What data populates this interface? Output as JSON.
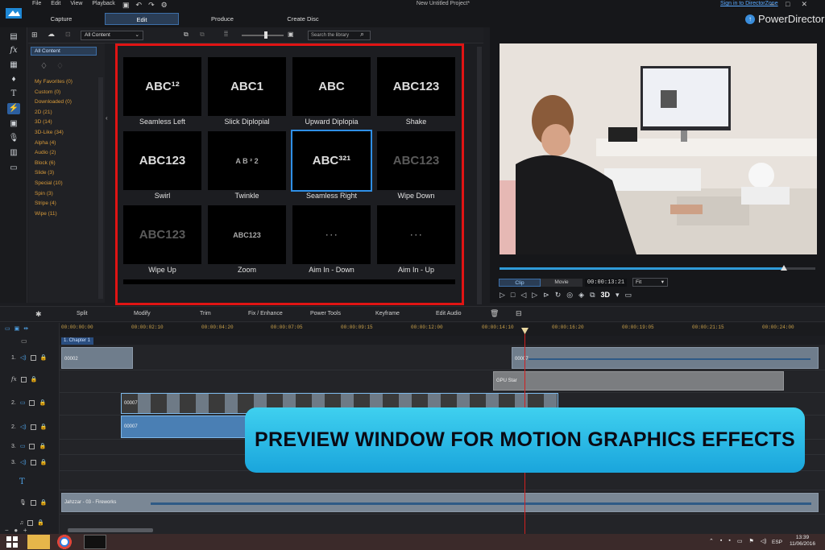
{
  "app": {
    "menu": [
      "File",
      "Edit",
      "View",
      "Playback"
    ],
    "project_title": "New Untitled Project*",
    "sign_in": "Sign in to DirectorZone",
    "brand": "PowerDirector",
    "modes": [
      "Capture",
      "Edit",
      "Produce",
      "Create Disc"
    ],
    "active_mode": "Edit"
  },
  "library": {
    "filter_value": "All Content",
    "search_placeholder": "Search the library",
    "categories_selected": "All Content",
    "categories": [
      "My Favorites  (0)",
      "Custom  (0)",
      "Downloaded  (0)",
      "2D  (21)",
      "3D  (14)",
      "3D-Like  (34)",
      "Alpha  (4)",
      "Audio  (2)",
      "Block  (6)",
      "Slide  (3)",
      "Special  (10)",
      "Spin  (3)",
      "Stripe  (4)",
      "Wipe  (11)"
    ],
    "tiles": [
      {
        "label": "Seamless Left",
        "thumb": "ABC¹²"
      },
      {
        "label": "Slick Diplopial",
        "thumb": "ABC1"
      },
      {
        "label": "Upward Diplopia",
        "thumb": "ABC"
      },
      {
        "label": "Shake",
        "thumb": "ABC123"
      },
      {
        "label": "Swirl",
        "thumb": "ABC123"
      },
      {
        "label": "Twinkle",
        "thumb": "A B ²  2"
      },
      {
        "label": "Seamless Right",
        "thumb": "ABC³²¹"
      },
      {
        "label": "Wipe Down",
        "thumb": "ABC123"
      },
      {
        "label": "Wipe Up",
        "thumb": "ABC123"
      },
      {
        "label": "Zoom",
        "thumb": "ABC123"
      },
      {
        "label": "Aim In - Down",
        "thumb": "· · ·"
      },
      {
        "label": "Aim In - Up",
        "thumb": "· · ·"
      }
    ]
  },
  "preview": {
    "tabs": [
      "Clip",
      "Movie"
    ],
    "active_tab": "Clip",
    "timecode": "00:00:13:21",
    "fit": "Fit",
    "progress": 0.9,
    "badge_3d": "3D"
  },
  "timeline": {
    "tools": [
      "Split",
      "Modify",
      "Trim",
      "Fix / Enhance",
      "Power Tools",
      "Keyframe",
      "Edit Audio"
    ],
    "ruler": [
      "00:00:00:00",
      "00:00:02:10",
      "00:00:04:20",
      "00:00:07:05",
      "00:00:09:15",
      "00:00:12:00",
      "00:00:14:10",
      "00:00:16:20",
      "00:00:19:05",
      "00:00:21:15",
      "00:00:24:00"
    ],
    "chapter": "1. Chapter 1",
    "tracks": [
      "1.",
      "fx",
      "2.",
      "2.",
      "3.",
      "3.",
      "T",
      "",
      ""
    ],
    "clips": {
      "a1_left": "00002",
      "a1_right": "00007",
      "fx": "GPU Star",
      "v2_label": "00007",
      "a2_label": "00007",
      "music": "Jahzzar - 03 - Fireworks"
    }
  },
  "banner": "PREVIEW WINDOW FOR MOTION GRAPHICS EFFECTS",
  "taskbar": {
    "lang": "ESP",
    "time": "13:39",
    "date": "11/06/2016"
  },
  "colors": {
    "highlight_frame": "#e01414",
    "accent": "#2f8fe6",
    "banner": "#29b8e4"
  }
}
